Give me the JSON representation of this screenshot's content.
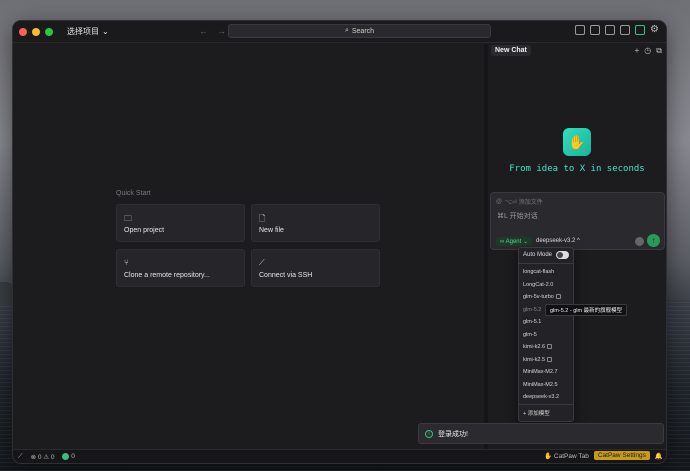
{
  "titlebar": {
    "project_selector": "选择项目",
    "search_label": "Search"
  },
  "quick_start": {
    "title": "Quick Start",
    "cards": [
      {
        "label": "Open project",
        "icon": "folder-icon"
      },
      {
        "label": "New file",
        "icon": "file-plus-icon"
      },
      {
        "label": "Clone a remote repository...",
        "icon": "git-branch-icon"
      },
      {
        "label": "Connect via SSH",
        "icon": "ssh-icon"
      }
    ]
  },
  "chat": {
    "tab_label": "New Chat",
    "tagline": "From idea to X in seconds",
    "attach_hint": "⌥⏎ 添加文件",
    "placeholder": "⌘L 开始对话",
    "agent_label": "∞ Agent ⌄",
    "model_label": "deepseek-v3.2 ^"
  },
  "model_dropdown": {
    "auto_mode_label": "Auto Mode",
    "auto_mode_on": true,
    "models": [
      {
        "name": "longcat-flash",
        "badge": false
      },
      {
        "name": "LongCat-2.0",
        "badge": false
      },
      {
        "name": "glm-5v-turbo",
        "badge": true
      },
      {
        "name": "glm-5.2",
        "badge": false
      },
      {
        "name": "glm-5.1",
        "badge": false
      },
      {
        "name": "glm-5",
        "badge": false
      },
      {
        "name": "kimi-k2.6",
        "badge": true
      },
      {
        "name": "kimi-k2.5",
        "badge": true
      },
      {
        "name": "MiniMax-M2.7",
        "badge": false
      },
      {
        "name": "MiniMax-M2.5",
        "badge": false
      },
      {
        "name": "deepseek-v3.2",
        "badge": false
      }
    ],
    "add_model_label": "+ 添加模型",
    "tooltip": "glm-5.2 - glm 最新的旗舰模型"
  },
  "toast": {
    "message": "登录成功!"
  },
  "statusbar": {
    "errors_warnings": "⊗ 0 ⚠ 0",
    "ok_count": "0",
    "catpaw_tab": "CatPaw Tab",
    "catpaw_settings": "CatPaw Settings"
  }
}
